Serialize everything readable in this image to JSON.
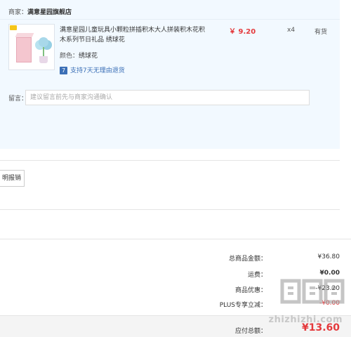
{
  "shop": {
    "prefix": "商家：",
    "name": "满意星园旗舰店"
  },
  "product": {
    "title": "满意星园儿童玩具小颗粒拼插积木大人拼装积木花积木系列节日礼品 绣球花",
    "spec_label": "颜色：",
    "spec_value": "绣球花",
    "service_icon": "7",
    "service": "支持7天无理由退货",
    "price": "￥ 9.20",
    "quantity": "x4",
    "stock": "有货"
  },
  "message": {
    "label": "留言：",
    "placeholder": "建议留言前先与商家沟通确认"
  },
  "invoice": {
    "button_label": "明报销"
  },
  "summary": {
    "total_label": "总商品金额：",
    "total_value": "¥36.80",
    "shipping_label": "运费：",
    "shipping_value": "¥0.00",
    "discount_label": "商品优惠：",
    "discount_value": "-¥23.20",
    "plus_label": "PLUS专享立减：",
    "plus_value": "-¥0.00",
    "pay_label": "应付总额：",
    "pay_value": "¥13.60"
  },
  "watermark": {
    "text": "zhizhizhi.com",
    "logo": "值值值"
  },
  "colors": {
    "accent_red": "#e4393c",
    "panel_bg": "#f2f9ff",
    "link_blue": "#3b6fb6"
  }
}
